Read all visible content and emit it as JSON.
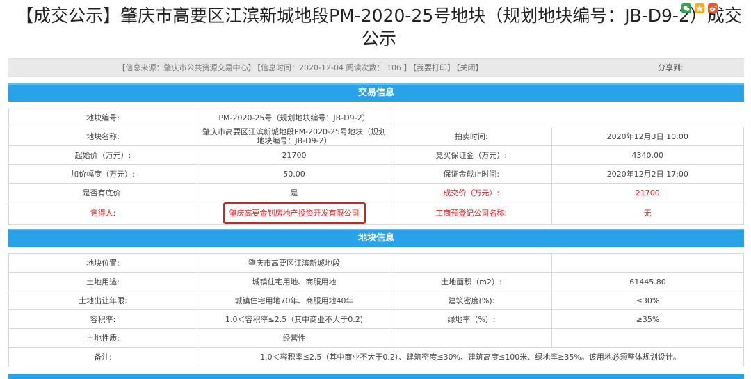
{
  "title": "【成交公示】肇庆市高要区江滨新城地段PM-2020-25号地块（规划地块编号：JB-D9-2）成交公示",
  "infobar": {
    "source": "【信息来源：肇庆市公共资源交易中心】",
    "time": "【信息时间：2020-12-04 阅读次数：  106 】",
    "print": "【我要打印】",
    "close": "【关闭】",
    "share_label": "分享到:"
  },
  "trade": {
    "heading": "交易信息",
    "rows": [
      {
        "l1": "地块编号:",
        "v1": "PM-2020-25号（规划地块编号：JB-D9-2）",
        "l2": "",
        "v2": ""
      },
      {
        "l1": "地块名称:",
        "v1": "肇庆市高要区江滨新城地段PM-2020-25号地块（规划地块编号：JB-D9-2）",
        "l2": "拍卖时间:",
        "v2": "2020年12月3日 10:00"
      },
      {
        "l1": "起始价（万元）:",
        "v1": "21700",
        "l2": "竞买保证金（万元）:",
        "v2": "4340.00"
      },
      {
        "l1": "加价幅度（万元）:",
        "v1": "50.00",
        "l2": "保证金截止时间:",
        "v2": "2020年12月2日 17:00"
      },
      {
        "l1": "是否有底价:",
        "v1": "是",
        "l2": "成交价（万元）:",
        "v2": "21700"
      },
      {
        "l1": "竞得人:",
        "v1": "肇庆高要金钊房地产投资开发有限公司",
        "l2": "工商预登记公司名称:",
        "v2": "无"
      }
    ]
  },
  "land": {
    "heading": "地块信息",
    "rows": [
      {
        "l1": "地块位置:",
        "v1": "肇庆市高要区江滨新城地段",
        "l2": "",
        "v2": ""
      },
      {
        "l1": "土地用途:",
        "v1": "城镇住宅用地、商服用地",
        "l2": "土地面积（m2）:",
        "v2": "61445.80"
      },
      {
        "l1": "土地出让年限:",
        "v1": "城镇住宅用地70年、商服用地40年",
        "l2": "建筑密度(%):",
        "v2": "≤30%"
      },
      {
        "l1": "容积率:",
        "v1": "1.0＜容积率≤2.5（其中商业不大于0.2)",
        "l2": "绿地率（%）:",
        "v2": "≥35%"
      },
      {
        "l1": "土地性质:",
        "v1": "经营性",
        "l2": "",
        "v2": ""
      }
    ],
    "remark_label": "备注:",
    "remark": "1.0＜容积率≤2.5（其中商业不大于0.2）、建筑密度≤30%、建筑高度≤100米、绿地率≥35%。该用地必须整体规划设计。"
  },
  "colors": {
    "accent": "#29a3e8",
    "highlight": "#e31b1b"
  }
}
